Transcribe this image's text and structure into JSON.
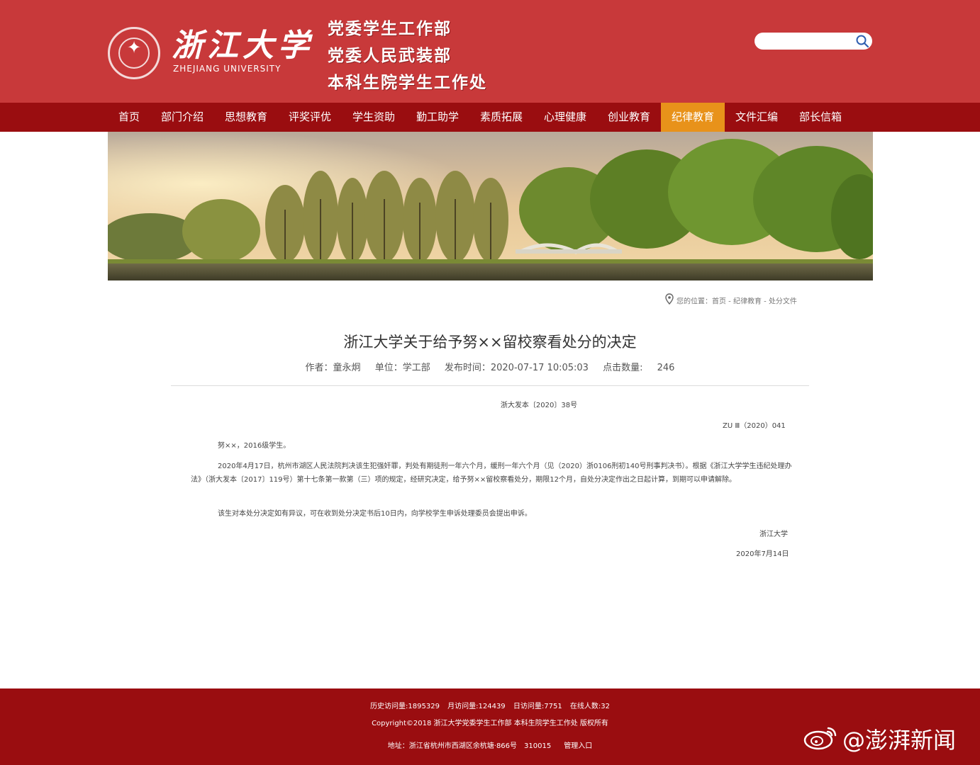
{
  "header": {
    "logo_cn": "浙江大学",
    "logo_en": "ZHEJIANG UNIVERSITY",
    "departments": [
      "党委学生工作部",
      "党委人民武装部",
      "本科生院学生工作处"
    ],
    "search": {
      "value": "",
      "placeholder": ""
    }
  },
  "nav": {
    "items": [
      "首页",
      "部门介绍",
      "思想教育",
      "评奖评优",
      "学生资助",
      "勤工助学",
      "素质拓展",
      "心理健康",
      "创业教育",
      "纪律教育",
      "文件汇编",
      "部长信箱"
    ],
    "active": "纪律教育"
  },
  "breadcrumb": {
    "prefix": "您的位置：",
    "home": "首页",
    "sep1": " - ",
    "section": "纪律教育",
    "sep2": " - ",
    "page": "处分文件"
  },
  "article": {
    "title": "浙江大学关于给予努××留校察看处分的决定",
    "meta": {
      "author": "作者：童永炯",
      "unit": "单位：学工部",
      "published": "发布时间：2020-07-17 10:05:03",
      "clicks_label": "点击数量:",
      "clicks_value": "246"
    },
    "doc_number": "浙大发本〔2020〕38号",
    "doc_code": "ZU Ⅲ（2020）041",
    "paragraphs": [
      "努××，2016级学生。",
      "2020年4月17日，杭州市湖区人民法院判决该生犯强奸罪，判处有期徒刑一年六个月，缓刑一年六个月（见（2020）浙0106刑初140号刑事判决书）。根据《浙江大学学生违纪处理办法》（浙大发本〔2017〕119号）第十七条第一款第（三）项的规定，经研究决定，给予努××留校察看处分，期限12个月，自处分决定作出之日起计算，到期可以申请解除。",
      "该生对本处分决定如有异议，可在收到处分决定书后10日内，向学校学生申诉处理委员会提出申诉。"
    ],
    "signature_org": "浙江大学",
    "signature_date": "2020年7月14日"
  },
  "footer": {
    "stats": [
      "历史访问量:1895329",
      "月访问量:124439",
      "日访问量:7751",
      "在线人数:32"
    ],
    "copyright": "Copyright©2018 浙江大学党委学生工作部 本科生院学生工作处 版权所有",
    "address": "地址：浙江省杭州市西湖区余杭塘·866号　310015",
    "admin_link": "管理入口"
  },
  "watermark": {
    "text": "@澎湃新闻",
    "icon": "weibo-icon"
  },
  "icons": {
    "search": "search-icon",
    "location": "location-pin-icon"
  },
  "colors": {
    "header": "#c8393a",
    "nav": "#9a0d10",
    "nav_active": "#e8921a",
    "footer": "#9a0d10"
  }
}
